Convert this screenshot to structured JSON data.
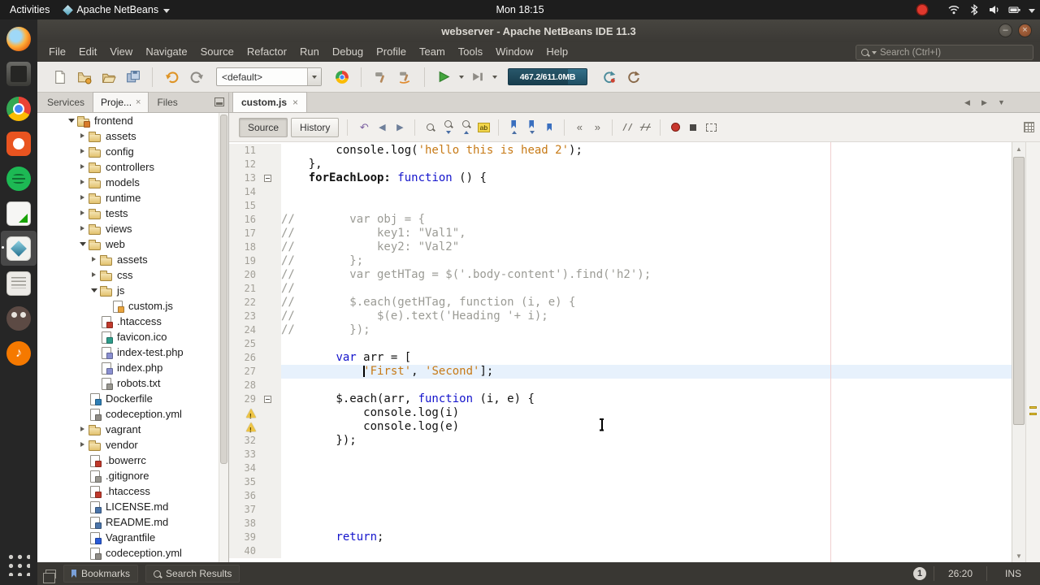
{
  "os_bar": {
    "activities": "Activities",
    "app_name": "Apache NetBeans",
    "clock": "Mon 18:15",
    "tray_icons": [
      "screen-record",
      "network",
      "bluetooth",
      "volume",
      "battery",
      "menu-caret"
    ]
  },
  "window": {
    "title": "webserver - Apache NetBeans IDE 11.3"
  },
  "menu_bar": {
    "items": [
      "File",
      "Edit",
      "View",
      "Navigate",
      "Source",
      "Refactor",
      "Run",
      "Debug",
      "Profile",
      "Team",
      "Tools",
      "Window",
      "Help"
    ],
    "search_placeholder": "Search (Ctrl+I)"
  },
  "toolbar": {
    "config": "<default>",
    "memory": "467.2/611.0MB",
    "icons": [
      "new-file",
      "new-project",
      "open-project",
      "save-all",
      "undo",
      "redo",
      "browser-chrome",
      "build-project",
      "clean-build-project",
      "run-project",
      "debug-project",
      "perform-gc",
      "profile-gc"
    ]
  },
  "dock": {
    "icons": [
      "firefox",
      "terminal",
      "chrome",
      "software-center",
      "spotify",
      "libreoffice-calc",
      "netbeans",
      "text-editor",
      "gimp",
      "media-player",
      "show-applications"
    ],
    "active": "netbeans"
  },
  "panels": {
    "tabs": [
      {
        "label": "Services",
        "active": false,
        "closable": false
      },
      {
        "label": "Proje...",
        "active": true,
        "closable": true
      },
      {
        "label": "Files",
        "active": false,
        "closable": false
      }
    ]
  },
  "tree": [
    {
      "d": 0,
      "label": "frontend",
      "kind": "project",
      "exp": "open"
    },
    {
      "d": 1,
      "label": "assets",
      "kind": "folder",
      "exp": "closed"
    },
    {
      "d": 1,
      "label": "config",
      "kind": "folder",
      "exp": "closed"
    },
    {
      "d": 1,
      "label": "controllers",
      "kind": "folder",
      "exp": "closed"
    },
    {
      "d": 1,
      "label": "models",
      "kind": "folder",
      "exp": "closed"
    },
    {
      "d": 1,
      "label": "runtime",
      "kind": "folder",
      "exp": "closed"
    },
    {
      "d": 1,
      "label": "tests",
      "kind": "folder",
      "exp": "closed"
    },
    {
      "d": 1,
      "label": "views",
      "kind": "folder",
      "exp": "closed"
    },
    {
      "d": 1,
      "label": "web",
      "kind": "folder",
      "exp": "open"
    },
    {
      "d": 2,
      "label": "assets",
      "kind": "folder",
      "exp": "closed"
    },
    {
      "d": 2,
      "label": "css",
      "kind": "folder",
      "exp": "closed"
    },
    {
      "d": 2,
      "label": "js",
      "kind": "folder",
      "exp": "open"
    },
    {
      "d": 3,
      "label": "custom.js",
      "kind": "js"
    },
    {
      "d": 2,
      "label": ".htaccess",
      "kind": "conf"
    },
    {
      "d": 2,
      "label": "favicon.ico",
      "kind": "img"
    },
    {
      "d": 2,
      "label": "index-test.php",
      "kind": "php"
    },
    {
      "d": 2,
      "label": "index.php",
      "kind": "php"
    },
    {
      "d": 2,
      "label": "robots.txt",
      "kind": "txt"
    },
    {
      "d": 1,
      "label": "Dockerfile",
      "kind": "docker"
    },
    {
      "d": 1,
      "label": "codeception.yml",
      "kind": "yml"
    },
    {
      "d": 1,
      "label": "vagrant",
      "kind": "folder",
      "exp": "closed"
    },
    {
      "d": 1,
      "label": "vendor",
      "kind": "folder",
      "exp": "closed"
    },
    {
      "d": 1,
      "label": ".bowerrc",
      "kind": "conf"
    },
    {
      "d": 1,
      "label": ".gitignore",
      "kind": "txt"
    },
    {
      "d": 1,
      "label": ".htaccess",
      "kind": "conf"
    },
    {
      "d": 1,
      "label": "LICENSE.md",
      "kind": "md"
    },
    {
      "d": 1,
      "label": "README.md",
      "kind": "md"
    },
    {
      "d": 1,
      "label": "Vagrantfile",
      "kind": "vf"
    },
    {
      "d": 1,
      "label": "codeception.yml",
      "kind": "yml"
    }
  ],
  "editor": {
    "tab": {
      "label": "custom.js",
      "closable": true
    },
    "views": [
      "Source",
      "History"
    ],
    "current_line": 27,
    "toolbar_icons": [
      "last-edit",
      "back",
      "forward",
      "find-selection",
      "find-next",
      "find-previous",
      "toggle-highlight",
      "previous-bookmark",
      "next-bookmark",
      "toggle-bookmark",
      "shift-left",
      "shift-right",
      "comment",
      "uncomment",
      "start-macro",
      "stop-macro",
      "rect-selection"
    ],
    "lines": [
      {
        "no": 11,
        "segs": [
          {
            "c": "p",
            "t": "        console.log("
          },
          {
            "c": "s",
            "t": "'hello this is head 2'"
          },
          {
            "c": "p",
            "t": ");"
          }
        ]
      },
      {
        "no": 12,
        "segs": [
          {
            "c": "p",
            "t": "    },"
          }
        ]
      },
      {
        "no": 13,
        "fold": true,
        "segs": [
          {
            "c": "b",
            "t": "    forEachLoop:"
          },
          {
            "c": "p",
            "t": " "
          },
          {
            "c": "k",
            "t": "function"
          },
          {
            "c": "p",
            "t": " () {"
          }
        ]
      },
      {
        "no": 14,
        "segs": []
      },
      {
        "no": 15,
        "segs": []
      },
      {
        "no": 16,
        "segs": [
          {
            "c": "c",
            "t": "//        var obj = {"
          }
        ]
      },
      {
        "no": 17,
        "segs": [
          {
            "c": "c",
            "t": "//            key1: \"Val1\","
          }
        ]
      },
      {
        "no": 18,
        "segs": [
          {
            "c": "c",
            "t": "//            key2: \"Val2\""
          }
        ]
      },
      {
        "no": 19,
        "segs": [
          {
            "c": "c",
            "t": "//        };"
          }
        ]
      },
      {
        "no": 20,
        "segs": [
          {
            "c": "c",
            "t": "//        var getHTag = $('.body-content').find('h2');"
          }
        ]
      },
      {
        "no": 21,
        "segs": [
          {
            "c": "c",
            "t": "//"
          }
        ]
      },
      {
        "no": 22,
        "segs": [
          {
            "c": "c",
            "t": "//        $.each(getHTag, function (i, e) {"
          }
        ]
      },
      {
        "no": 23,
        "segs": [
          {
            "c": "c",
            "t": "//            $(e).text('Heading '+ i);"
          }
        ]
      },
      {
        "no": 24,
        "segs": [
          {
            "c": "c",
            "t": "//        });"
          }
        ]
      },
      {
        "no": 25,
        "segs": []
      },
      {
        "no": 26,
        "segs": [
          {
            "c": "p",
            "t": "        "
          },
          {
            "c": "k",
            "t": "var"
          },
          {
            "c": "p",
            "t": " arr = ["
          }
        ]
      },
      {
        "no": 27,
        "segs": [
          {
            "c": "p",
            "t": "            "
          },
          {
            "caret": true
          },
          {
            "c": "s",
            "t": "'First'"
          },
          {
            "c": "p",
            "t": ", "
          },
          {
            "c": "s",
            "t": "'Second'"
          },
          {
            "c": "p",
            "t": "];"
          }
        ]
      },
      {
        "no": 28,
        "segs": []
      },
      {
        "no": 29,
        "fold": true,
        "segs": [
          {
            "c": "p",
            "t": "        $.each(arr, "
          },
          {
            "c": "k",
            "t": "function"
          },
          {
            "c": "p",
            "t": " (i, e) {"
          }
        ]
      },
      {
        "no": 30,
        "warn": true,
        "segs": [
          {
            "c": "p",
            "t": "            console.log(i)"
          }
        ]
      },
      {
        "no": 31,
        "warn": true,
        "segs": [
          {
            "c": "p",
            "t": "            console.log(e)"
          }
        ]
      },
      {
        "no": 32,
        "segs": [
          {
            "c": "p",
            "t": "        });"
          }
        ]
      },
      {
        "no": 33,
        "segs": []
      },
      {
        "no": 34,
        "segs": []
      },
      {
        "no": 35,
        "segs": []
      },
      {
        "no": 36,
        "segs": []
      },
      {
        "no": 37,
        "segs": []
      },
      {
        "no": 38,
        "segs": []
      },
      {
        "no": 39,
        "segs": [
          {
            "c": "p",
            "t": "        "
          },
          {
            "c": "k",
            "t": "return"
          },
          {
            "c": "p",
            "t": ";"
          }
        ]
      },
      {
        "no": 40,
        "segs": []
      }
    ]
  },
  "status_bar": {
    "bookmarks": "Bookmarks",
    "search_results": "Search Results",
    "notifications": "1",
    "caret_position": "26:20",
    "insert_mode": "INS"
  },
  "colors": {
    "keyword": "#1414cc",
    "string": "#c77a16",
    "comment": "#9b9b95",
    "run_green": "#44a53d",
    "memory_teal": "#2a607a"
  }
}
